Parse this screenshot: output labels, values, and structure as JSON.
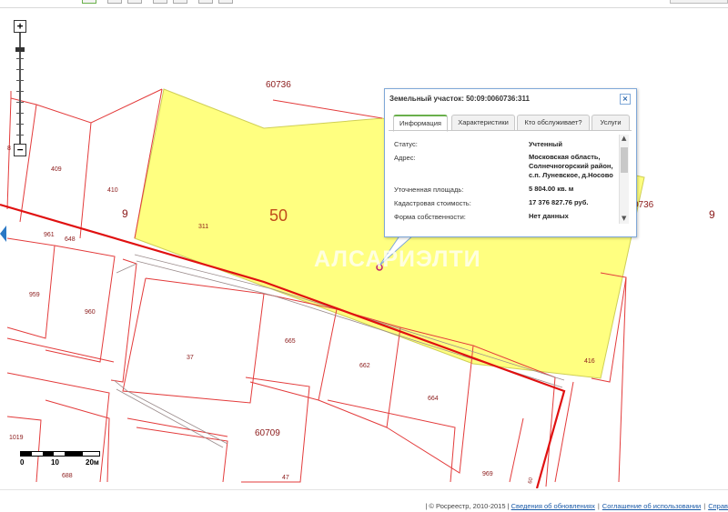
{
  "map": {
    "quarter_labels": [
      {
        "id": "q60736-top",
        "text": "60736"
      },
      {
        "id": "q60736-right",
        "text": "0736"
      },
      {
        "id": "q60709",
        "text": "60709"
      }
    ],
    "big_labels": [
      {
        "id": "b50",
        "text": "50"
      },
      {
        "id": "b9-left",
        "text": "9"
      },
      {
        "id": "b9-right",
        "text": "9"
      }
    ],
    "plot_labels": [
      {
        "id": "p409",
        "text": "409"
      },
      {
        "id": "p410",
        "text": "410"
      },
      {
        "id": "p8",
        "text": "8"
      },
      {
        "id": "p311",
        "text": "311"
      },
      {
        "id": "p961",
        "text": "961"
      },
      {
        "id": "p648",
        "text": "648"
      },
      {
        "id": "p959",
        "text": "959"
      },
      {
        "id": "p960",
        "text": "960"
      },
      {
        "id": "p37",
        "text": "37"
      },
      {
        "id": "p665",
        "text": "665"
      },
      {
        "id": "p662",
        "text": "662"
      },
      {
        "id": "p664",
        "text": "664"
      },
      {
        "id": "p416",
        "text": "416"
      },
      {
        "id": "p1019",
        "text": "1019"
      },
      {
        "id": "p688",
        "text": "688"
      },
      {
        "id": "p47",
        "text": "47"
      },
      {
        "id": "p969",
        "text": "969"
      },
      {
        "id": "p60",
        "text": "60"
      }
    ],
    "colors": {
      "parcel_fill": "#ffff80",
      "boundary": "#e33b3b",
      "road": "#e01010",
      "selected_outline": "#cfcf55"
    },
    "watermark": "АЛСАРИЭЛТИ",
    "zoom": {
      "plus": "+",
      "minus": "−"
    },
    "scale": {
      "labels": [
        "0",
        "10",
        "20м"
      ]
    }
  },
  "popup": {
    "title": "Земельный участок: 50:09:0060736:311",
    "close": "×",
    "tabs": [
      "Информация",
      "Характеристики",
      "Кто обслуживает?",
      "Услуги"
    ],
    "active_tab": "Информация",
    "rows": [
      {
        "key": "Статус:",
        "value": "Учтенный"
      },
      {
        "key": "Адрес:",
        "value": "Московская область, Солнечногорский район, с.п. Луневское, д.Носово"
      },
      {
        "key": "Уточненная площадь:",
        "value": "5 804.00 кв. м"
      },
      {
        "key": "Кадастровая стоимость:",
        "value": "17 376 827.76 руб."
      },
      {
        "key": "Форма собственности:",
        "value": "Нет данных"
      }
    ]
  },
  "footer": {
    "copyright": "| © Росреестр, 2010-2015 |",
    "links": [
      "Сведения об обновлениях",
      "Соглашение об использовании",
      "Справ"
    ]
  }
}
